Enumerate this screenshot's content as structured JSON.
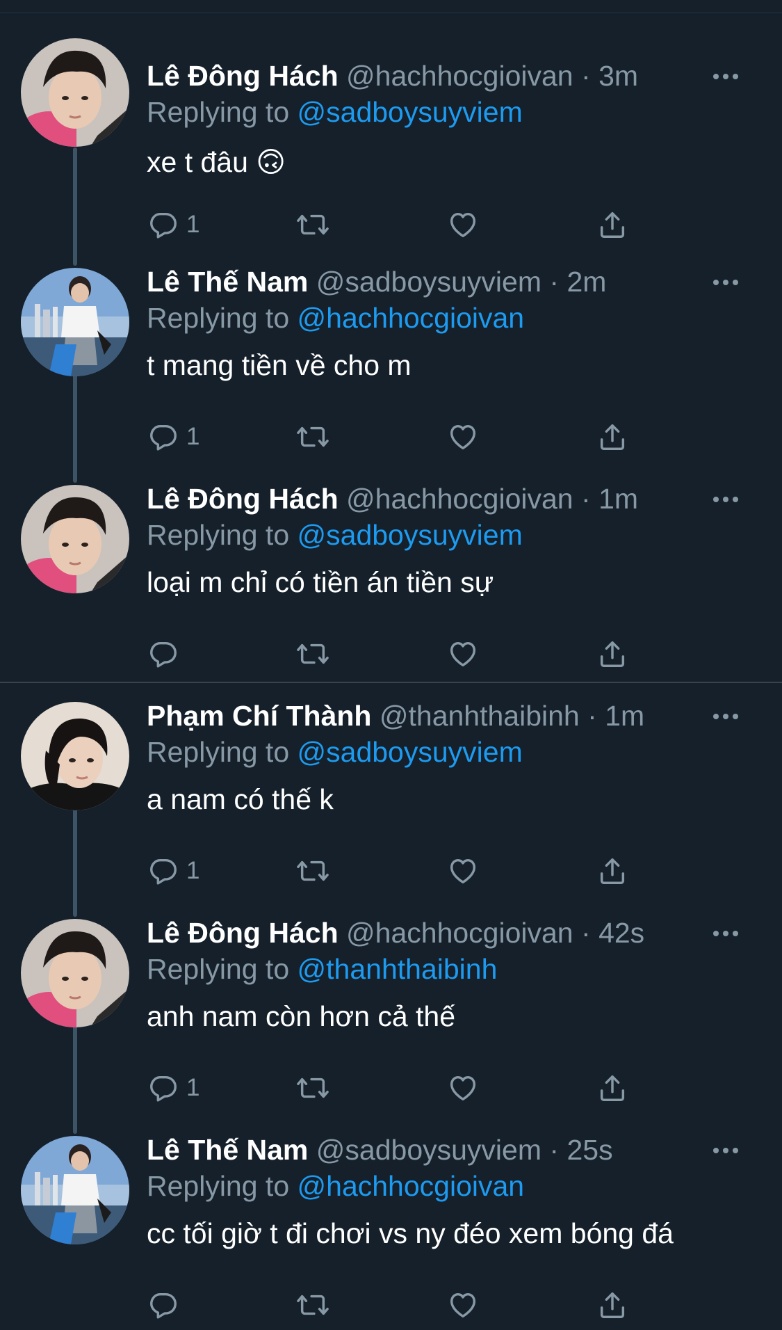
{
  "tweets": [
    {
      "name": "Lê Đông Hách",
      "handle": "@hachhocgioivan",
      "dot": "·",
      "time": "3m",
      "reply_prefix": "Replying to",
      "reply_to": "@sadboysuyviem",
      "text": "xe t đâu 🙃",
      "reply_count": "1",
      "avatar": "pink-hoodie-boy"
    },
    {
      "name": "Lê Thế Nam",
      "handle": "@sadboysuyviem",
      "dot": "·",
      "time": "2m",
      "reply_prefix": "Replying to",
      "reply_to": "@hachhocgioivan",
      "text": "t mang tiền về cho m",
      "reply_count": "1",
      "avatar": "boy-city-waterfront"
    },
    {
      "name": "Lê Đông Hách",
      "handle": "@hachhocgioivan",
      "dot": "·",
      "time": "1m",
      "reply_prefix": "Replying to",
      "reply_to": "@sadboysuyviem",
      "text": "loại m chỉ có tiền án tiền sự",
      "reply_count": "",
      "avatar": "pink-hoodie-boy"
    },
    {
      "name": "Phạm Chí Thành",
      "handle": "@thanhthaibinh",
      "dot": "·",
      "time": "1m",
      "reply_prefix": "Replying to",
      "reply_to": "@sadboysuyviem",
      "text": "a nam có thế k",
      "reply_count": "1",
      "avatar": "dark-hair-boy"
    },
    {
      "name": "Lê Đông Hách",
      "handle": "@hachhocgioivan",
      "dot": "·",
      "time": "42s",
      "reply_prefix": "Replying to",
      "reply_to": "@thanhthaibinh",
      "text": "anh nam còn hơn cả thế",
      "reply_count": "1",
      "avatar": "pink-hoodie-boy"
    },
    {
      "name": "Lê Thế Nam",
      "handle": "@sadboysuyviem",
      "dot": "·",
      "time": "25s",
      "reply_prefix": "Replying to",
      "reply_to": "@hachhocgioivan",
      "text": "cc tối giờ t đi chơi vs ny đéo xem bóng đá",
      "reply_count": "",
      "avatar": "boy-city-waterfront"
    }
  ],
  "icons": {
    "more": "more-horizontal-icon",
    "reply": "reply-bubble-icon",
    "retweet": "retweet-icon",
    "like": "heart-icon",
    "share": "share-icon"
  },
  "colors": {
    "background": "#15202b",
    "secondary_text": "#8899a6",
    "link": "#1d9bf0",
    "thread_line": "#3d5466",
    "divider": "#38444d"
  }
}
